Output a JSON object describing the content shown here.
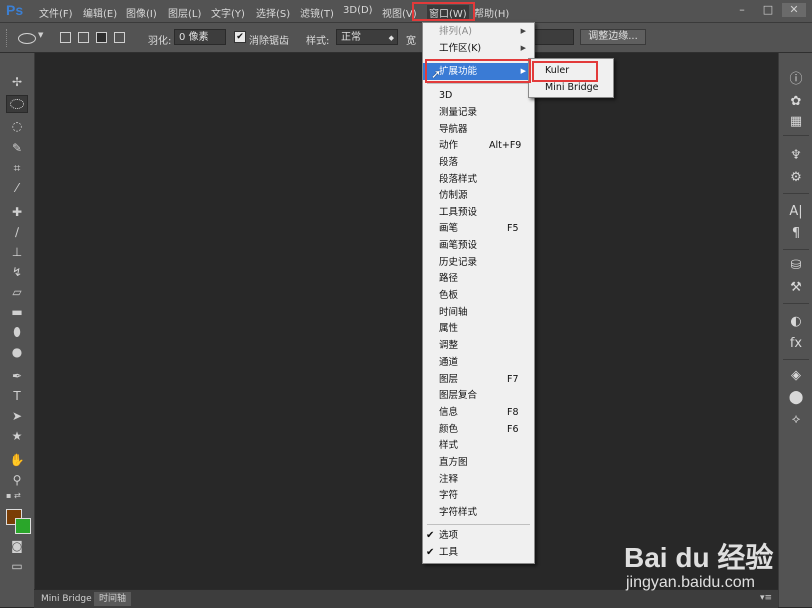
{
  "app": {
    "logo": "Ps"
  },
  "menubar": {
    "items": [
      "文件(F)",
      "编辑(E)",
      "图像(I)",
      "图层(L)",
      "文字(Y)",
      "选择(S)",
      "滤镜(T)",
      "3D(D)",
      "视图(V)",
      "窗口(W)",
      "帮助(H)"
    ],
    "window_controls": {
      "minimize": "–",
      "restore": "□",
      "close": "✕"
    }
  },
  "options": {
    "feather_label": "羽化:",
    "feather_value": "0 像素",
    "antialias_label": "消除锯齿",
    "style_label": "样式:",
    "style_value": "正常",
    "width_label": "宽",
    "refine_edge": "调整边缘..."
  },
  "window_menu": {
    "items": [
      {
        "label": "排列(A)",
        "shortcut": "",
        "submenu": true,
        "state": "dim"
      },
      {
        "label": "工作区(K)",
        "shortcut": "",
        "submenu": true,
        "state": ""
      },
      {
        "label": "扩展功能",
        "shortcut": "",
        "submenu": true,
        "state": "highlighted"
      },
      {
        "label": "3D",
        "shortcut": ""
      },
      {
        "label": "测量记录",
        "shortcut": ""
      },
      {
        "label": "导航器",
        "shortcut": ""
      },
      {
        "label": "动作",
        "shortcut": "Alt+F9"
      },
      {
        "label": "段落",
        "shortcut": ""
      },
      {
        "label": "段落样式",
        "shortcut": ""
      },
      {
        "label": "仿制源",
        "shortcut": ""
      },
      {
        "label": "工具预设",
        "shortcut": ""
      },
      {
        "label": "画笔",
        "shortcut": "F5"
      },
      {
        "label": "画笔预设",
        "shortcut": ""
      },
      {
        "label": "历史记录",
        "shortcut": ""
      },
      {
        "label": "路径",
        "shortcut": ""
      },
      {
        "label": "色板",
        "shortcut": ""
      },
      {
        "label": "时间轴",
        "shortcut": ""
      },
      {
        "label": "属性",
        "shortcut": ""
      },
      {
        "label": "调整",
        "shortcut": ""
      },
      {
        "label": "通道",
        "shortcut": ""
      },
      {
        "label": "图层",
        "shortcut": "F7"
      },
      {
        "label": "图层复合",
        "shortcut": ""
      },
      {
        "label": "信息",
        "shortcut": "F8"
      },
      {
        "label": "颜色",
        "shortcut": "F6"
      },
      {
        "label": "样式",
        "shortcut": ""
      },
      {
        "label": "直方图",
        "shortcut": ""
      },
      {
        "label": "注释",
        "shortcut": ""
      },
      {
        "label": "字符",
        "shortcut": ""
      },
      {
        "label": "字符样式",
        "shortcut": ""
      }
    ],
    "checked_items": [
      {
        "label": "选项",
        "checked": true
      },
      {
        "label": "工具",
        "checked": true
      }
    ]
  },
  "extensions_submenu": {
    "items": [
      "Kuler",
      "Mini Bridge"
    ]
  },
  "bottom_tabs": [
    "Mini Bridge",
    "时间轴"
  ],
  "colors": {
    "foreground": "#7a3e06",
    "background": "#2aa62a",
    "highlight": "#3a7bd5",
    "annotation": "#e23a3a"
  },
  "watermark": {
    "logo": "Bai du 经验",
    "url": "jingyan.baidu.com"
  }
}
